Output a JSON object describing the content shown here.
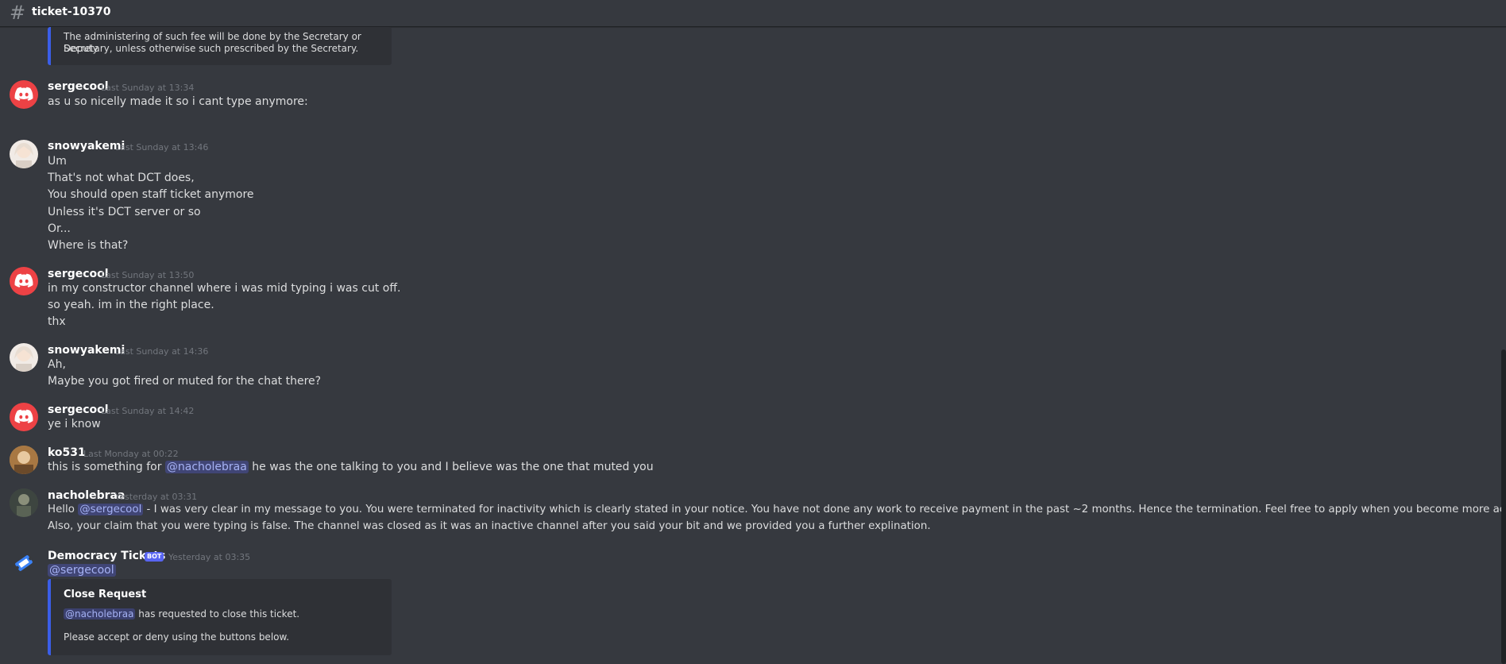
{
  "channel": {
    "name": "ticket-10370",
    "icon": "hash-icon"
  },
  "colors": {
    "accent": "#5865f2",
    "embed_bar": "#3b5ee8",
    "background": "#36393f",
    "mention": "#a5b2f4"
  },
  "top_embed": {
    "line1": "The administering of such fee will be done by the Secretary or Deputy",
    "line2": "Secretary, unless otherwise such prescribed by the Secretary."
  },
  "messages": [
    {
      "author": "sergecool",
      "time": "Last Sunday at 13:34",
      "lines": [
        "as u so nicelly made it so i cant type anymore:"
      ]
    },
    {
      "author": "snowyakemi",
      "time": "Last Sunday at 13:46",
      "lines": [
        "Um",
        "That's not what DCT does,",
        "You should open staff ticket anymore",
        "Unless it's DCT server or so",
        "Or...",
        "Where is that?"
      ]
    },
    {
      "author": "sergecool",
      "time": "Last Sunday at 13:50",
      "lines": [
        "in my constructor channel where i was mid typing i was cut off.",
        "so yeah. im in the right place.",
        "thx"
      ]
    },
    {
      "author": "snowyakemi",
      "time": "Last Sunday at 14:36",
      "lines": [
        "Ah,",
        "Maybe you got fired or muted for the chat there?"
      ]
    },
    {
      "author": "sergecool",
      "time": "Last Sunday at 14:42",
      "lines": [
        "ye i know"
      ]
    },
    {
      "author": "ko531",
      "time": "Last Monday at 00:22",
      "before": "this is something for ",
      "mention": "@nacholebraa",
      "after": " he was the one talking to you and I believe was the one that muted you"
    },
    {
      "author": "nacholebraa",
      "time": "Yesterday at 03:31",
      "before": "Hello ",
      "mention": "@sergecool",
      "after": " - I was very clear in my message to you. You were terminated for inactivity which is clearly stated in your notice. You have not done any work to receive payment in the past ~2 months. Hence the termination. Feel free to apply when you become more active.",
      "line2": "Also, your claim that you were typing is false. The channel was closed as it was an inactive channel after you said your bit and we provided you a further explination."
    },
    {
      "author": "Democracy Tickets",
      "badge": "BOT",
      "time": "Yesterday at 03:35",
      "mention": "@sergecool",
      "embed": {
        "title": "Close Request",
        "mention": "@nacholebraa",
        "text": " has requested to close this ticket.",
        "footer": "Please accept or deny using the buttons below."
      }
    }
  ]
}
